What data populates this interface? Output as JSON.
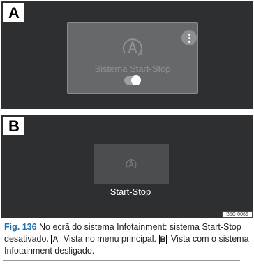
{
  "panel_a": {
    "label": "A",
    "tile": {
      "icon": "auto-start-stop-icon",
      "title": "Sistema Start-Stop",
      "menu_icon": "kebab-menu-icon",
      "toggle_state": "off"
    }
  },
  "panel_b": {
    "label": "B",
    "tile": {
      "icon": "auto-start-stop-icon",
      "title": "Start-Stop"
    }
  },
  "figure_code": "B5C-0066",
  "caption": {
    "fig_number": "Fig. 136",
    "text_1": " No ecrã do sistema Infotainment: sistema Start-Stop desativado. ",
    "ref_a": "A",
    "text_2": " Vista no menu principal. ",
    "ref_b": "B",
    "text_3": " Vista com o sistema Infotainment desligado."
  },
  "colors": {
    "panel_bg": "#2d2f31",
    "fig_number": "#1f6fb0"
  }
}
